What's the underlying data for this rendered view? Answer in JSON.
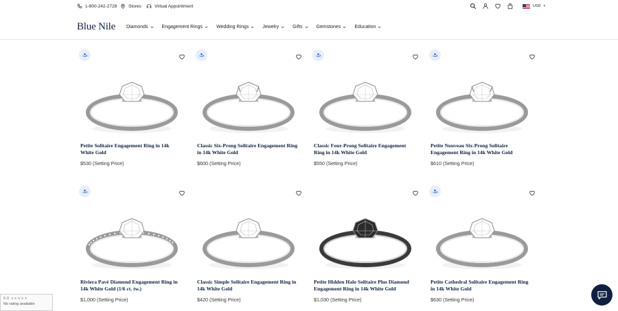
{
  "utility": {
    "phone": "1-800-242-2728",
    "stores": "Stores",
    "virtual_appointment": "Virtual Appointment",
    "currency": "USD"
  },
  "brand": {
    "logo": "Blue Nile"
  },
  "nav": {
    "items": [
      {
        "label": "Diamonds"
      },
      {
        "label": "Engagement Rings"
      },
      {
        "label": "Wedding Rings"
      },
      {
        "label": "Jewelry"
      },
      {
        "label": "Gifts"
      },
      {
        "label": "Gemstones"
      },
      {
        "label": "Education"
      }
    ]
  },
  "products": [
    {
      "title": "Petite Solitaire Engagement Ring in 14k White Gold",
      "price": "$530 (Setting Price)",
      "style": "plain"
    },
    {
      "title": "Classic Six-Prong Solitaire Engagement Ring in 14k White Gold",
      "price": "$600 (Setting Price)",
      "style": "six"
    },
    {
      "title": "Classic Four-Prong Solitaire Engagement Ring in 14k White Gold",
      "price": "$550 (Setting Price)",
      "style": "plain"
    },
    {
      "title": "Petite Nouveau Six-Prong Solitaire Engagement Ring in 14k White Gold",
      "price": "$610 (Setting Price)",
      "style": "six"
    },
    {
      "title": "Riviera Pavé Diamond Engagement Ring in 14k White Gold (1/6 ct. tw.)",
      "price": "$1,000 (Setting Price)",
      "style": "pave"
    },
    {
      "title": "Classic Simple Solitaire Engagement Ring in 14k White Gold",
      "price": "$420 (Setting Price)",
      "style": "tilt"
    },
    {
      "title": "Petite Hidden Halo Solitaire Plus Diamond Engagement Ring in 14k White Gold",
      "price": "$1,030 (Setting Price)",
      "style": "dark"
    },
    {
      "title": "Petite Cathedral Solitaire Engagement Ring in 14k White Gold",
      "price": "$630 (Setting Price)",
      "style": "plain"
    }
  ],
  "rating_widget": {
    "score": "0.0",
    "text": "No rating available"
  },
  "icons": {
    "badge": "360-view-icon",
    "wishlist": "heart-icon",
    "chat": "chat-icon"
  },
  "colors": {
    "brand_navy": "#10213f",
    "badge_bg": "#e8eef8",
    "badge_blue": "#2f6fdb"
  }
}
